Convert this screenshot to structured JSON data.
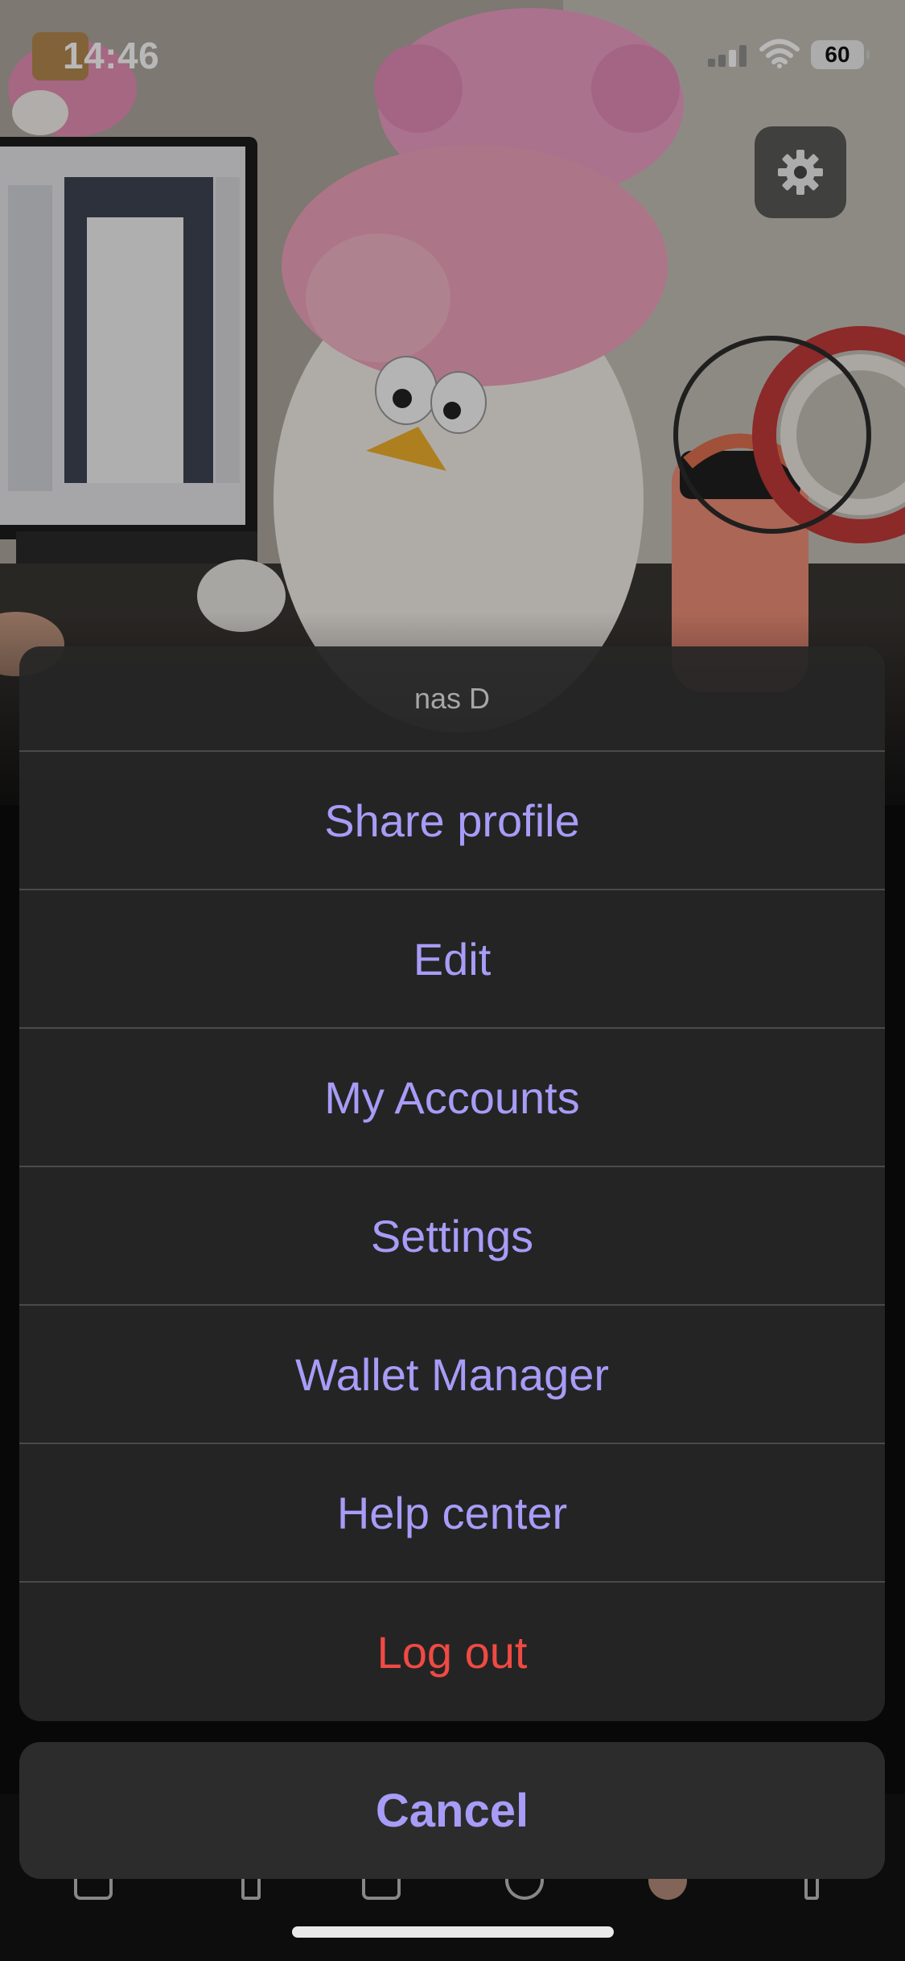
{
  "status_bar": {
    "time": "14:46",
    "battery": "60",
    "icons": [
      "signal-icon",
      "wifi-icon",
      "battery-icon"
    ]
  },
  "header": {
    "gear_icon": "gear-icon"
  },
  "action_sheet": {
    "title": "nas D",
    "items": [
      {
        "label": "Share profile",
        "style": "default"
      },
      {
        "label": "Edit",
        "style": "default"
      },
      {
        "label": "My Accounts",
        "style": "default"
      },
      {
        "label": "Settings",
        "style": "default"
      },
      {
        "label": "Wallet Manager",
        "style": "default"
      },
      {
        "label": "Help center",
        "style": "default"
      },
      {
        "label": "Log out",
        "style": "destructive"
      }
    ],
    "cancel_label": "Cancel"
  },
  "colors": {
    "accent": "#a79cf7",
    "destructive": "#f04a44",
    "sheet_background": "#262626",
    "separator": "#4a4a4a"
  }
}
